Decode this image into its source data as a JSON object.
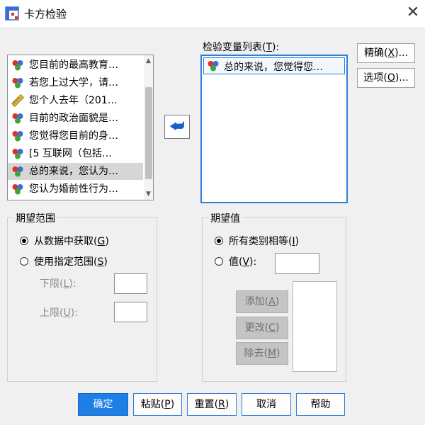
{
  "window": {
    "title": "卡方检验",
    "close_glyph": "✕"
  },
  "source_list": {
    "items": [
      {
        "label": "您目前的最高教育…",
        "icon": "nominal-variable-icon",
        "selected": false
      },
      {
        "label": "若您上过大学，请…",
        "icon": "nominal-variable-icon",
        "selected": false
      },
      {
        "label": "您个人去年（201…",
        "icon": "scale-variable-icon",
        "selected": false
      },
      {
        "label": "目前的政治面貌是…",
        "icon": "nominal-variable-icon",
        "selected": false
      },
      {
        "label": "您觉得您目前的身…",
        "icon": "nominal-variable-icon",
        "selected": false
      },
      {
        "label": "[5 互联网（包括…",
        "icon": "nominal-variable-icon",
        "selected": false
      },
      {
        "label": "总的来说，您认为…",
        "icon": "nominal-variable-icon",
        "selected": true
      },
      {
        "label": "您认为婚前性行为…",
        "icon": "nominal-variable-icon",
        "selected": false
      }
    ]
  },
  "move_button_glyph": "⮨",
  "test_list": {
    "label_text": "检验变量列表(",
    "label_key": "T",
    "label_end": "):",
    "items": [
      {
        "label": "总的来说，您觉得您…",
        "icon": "nominal-variable-icon"
      }
    ]
  },
  "side_buttons": {
    "exact": {
      "text": "精确(",
      "key": "X",
      "end": ")..."
    },
    "options": {
      "text": "选项(",
      "key": "O",
      "end": ")..."
    }
  },
  "expected_range": {
    "title": "期望范围",
    "from_data": {
      "text": "从数据中获取(",
      "key": "G",
      "end": ")",
      "checked": true
    },
    "specified": {
      "text": "使用指定范围(",
      "key": "S",
      "end": ")",
      "checked": false
    },
    "lower": {
      "text": "下限(",
      "key": "L",
      "end": "):"
    },
    "upper": {
      "text": "上限(",
      "key": "U",
      "end": "):"
    }
  },
  "expected_values": {
    "title": "期望值",
    "all_equal": {
      "text": "所有类别相等(",
      "key": "I",
      "end": ")",
      "checked": true
    },
    "values": {
      "text": "值(",
      "key": "V",
      "end": "):",
      "checked": false
    },
    "add": {
      "text": "添加(",
      "key": "A",
      "end": ")"
    },
    "change": {
      "text": "更改(",
      "key": "C",
      "end": ")"
    },
    "remove": {
      "text": "除去(",
      "key": "M",
      "end": ")"
    }
  },
  "bottom_buttons": {
    "ok": "确定",
    "paste": {
      "text": "粘贴(",
      "key": "P",
      "end": ")"
    },
    "reset": {
      "text": "重置(",
      "key": "R",
      "end": ")"
    },
    "cancel": "取消",
    "help": "帮助"
  },
  "colors": {
    "accent": "#1e7fe6",
    "focus_border": "#2f7ed8",
    "ball_red": "#d9342b",
    "ball_green": "#3aa53a",
    "ball_blue": "#3b6fd6"
  }
}
